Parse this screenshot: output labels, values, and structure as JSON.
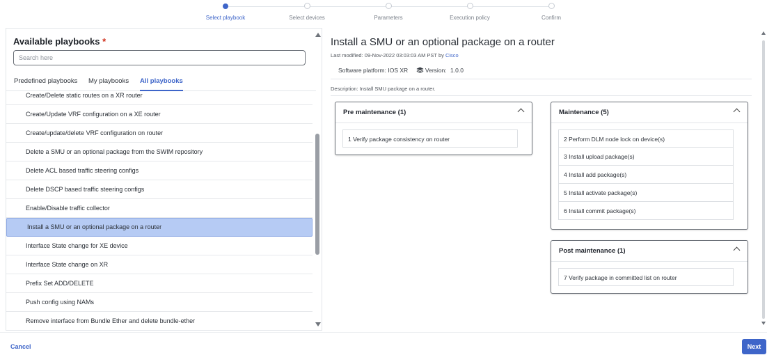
{
  "stepper": {
    "steps": [
      {
        "label": "Select playbook",
        "active": true
      },
      {
        "label": "Select devices",
        "active": false
      },
      {
        "label": "Parameters",
        "active": false
      },
      {
        "label": "Execution policy",
        "active": false
      },
      {
        "label": "Confirm",
        "active": false
      }
    ]
  },
  "left": {
    "title": "Available playbooks",
    "required_mark": "*",
    "search_placeholder": "Search here",
    "tabs": [
      {
        "label": "Predefined playbooks",
        "active": false
      },
      {
        "label": "My playbooks",
        "active": false
      },
      {
        "label": "All playbooks",
        "active": true
      }
    ],
    "items": [
      "Create/Delete static routes on a XR router",
      "Create/Update VRF configuration on a XE router",
      "Create/update/delete VRF configuration on router",
      "Delete a SMU or an optional package from the SWIM repository",
      "Delete ACL based traffic steering configs",
      "Delete DSCP based traffic steering configs",
      "Enable/Disable traffic collector",
      "Install a SMU or an optional package on a router",
      "Interface State change for XE device",
      "Interface State change on XR",
      "Prefix Set ADD/DELETE",
      "Push config using NAMs",
      "Remove interface from Bundle Ether and delete bundle-ether"
    ],
    "selected_index": 7
  },
  "detail": {
    "title": "Install a SMU or an optional package on a router",
    "last_modified_prefix": "Last modified: 09-Nov-2022 03:03:03 AM PST by",
    "author": "Cisco",
    "software_platform_label": "Software platform:",
    "software_platform_value": "IOS XR",
    "version_label": "Version:",
    "version_value": "1.0.0",
    "description": "Description: Install SMU package on a router.",
    "sections": {
      "pre": {
        "title": "Pre maintenance (1)",
        "steps": [
          "1 Verify package consistency on router"
        ]
      },
      "maintenance": {
        "title": "Maintenance (5)",
        "steps": [
          "2 Perform DLM node lock on device(s)",
          "3 Install upload package(s)",
          "4 Install add package(s)",
          "5 Install activate package(s)",
          "6 Install commit package(s)"
        ]
      },
      "post": {
        "title": "Post maintenance (1)",
        "steps": [
          "7 Verify package in committed list on router"
        ]
      }
    }
  },
  "footer": {
    "cancel_label": "Cancel",
    "next_label": "Next"
  },
  "colors": {
    "accent": "#3e65c9",
    "selected_row": "#b6cbf4",
    "required": "#d0301c"
  },
  "icons": {
    "version": "layers-icon",
    "collapse": "chevron-up-icon"
  }
}
